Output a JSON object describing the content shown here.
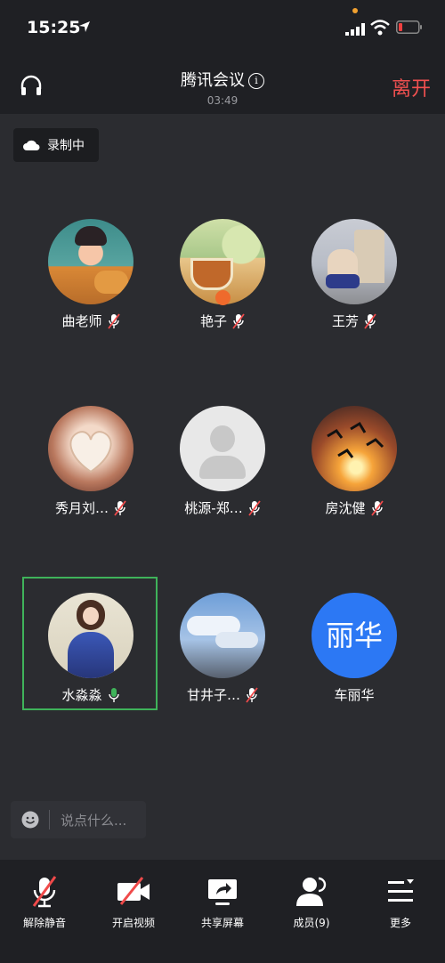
{
  "status": {
    "time": "15:25"
  },
  "header": {
    "title": "腾讯会议",
    "duration": "03:49",
    "leave_label": "离开"
  },
  "recording": {
    "label": "录制中"
  },
  "participants": [
    {
      "name": "曲老师",
      "mic": "muted"
    },
    {
      "name": "艳子",
      "mic": "muted"
    },
    {
      "name": "王芳",
      "mic": "muted"
    },
    {
      "name": "秀月刘…",
      "mic": "muted"
    },
    {
      "name": "桃源-郑…",
      "mic": "muted"
    },
    {
      "name": "房沈健",
      "mic": "muted"
    },
    {
      "name": "水淼淼",
      "mic": "active",
      "selected": true
    },
    {
      "name": "甘井子…",
      "mic": "muted"
    },
    {
      "name": "车丽华",
      "avatar_text": "丽华",
      "mic": "none"
    }
  ],
  "chat": {
    "placeholder": "说点什么..."
  },
  "toolbar": {
    "unmute": "解除静音",
    "video": "开启视频",
    "share": "共享屏幕",
    "members": "成员(9)",
    "more": "更多"
  },
  "colors": {
    "accent_red": "#f05050",
    "active_green": "#3fb35a",
    "avatar_blue": "#2c78f4"
  }
}
